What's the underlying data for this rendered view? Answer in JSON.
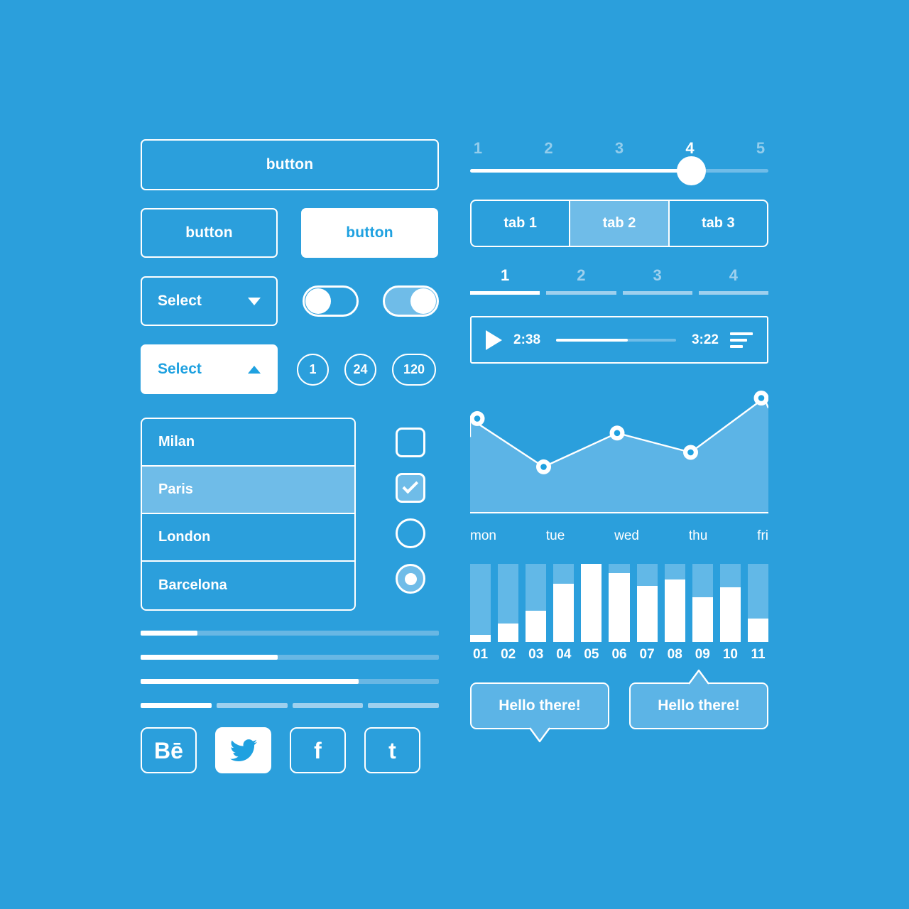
{
  "theme": {
    "background": "#2b9fdc",
    "accent_light": "#6fbce8",
    "white": "#ffffff",
    "text_on_white": "#1fa1e0",
    "muted": "#9ed0ee"
  },
  "buttons": {
    "wide_label": "button",
    "outline_label": "button",
    "solid_label": "button"
  },
  "selects": {
    "outline": {
      "label": "Select",
      "caret": "chevron-down-icon"
    },
    "white": {
      "label": "Select",
      "caret": "chevron-up-icon"
    }
  },
  "toggles": [
    {
      "name": "toggle-off",
      "state": "off"
    },
    {
      "name": "toggle-on",
      "state": "on"
    }
  ],
  "badges": [
    "1",
    "24",
    "120"
  ],
  "city_list": [
    {
      "label": "Milan",
      "selected": false
    },
    {
      "label": "Paris",
      "selected": true
    },
    {
      "label": "London",
      "selected": false
    },
    {
      "label": "Barcelona",
      "selected": false
    }
  ],
  "choices": [
    {
      "type": "checkbox",
      "checked": false
    },
    {
      "type": "checkbox",
      "checked": true
    },
    {
      "type": "radio",
      "checked": false
    },
    {
      "type": "radio",
      "checked": true
    }
  ],
  "progress": {
    "bars": [
      19,
      46,
      73
    ],
    "segmented": {
      "segments": 4,
      "filled": 1
    }
  },
  "socials": [
    {
      "name": "behance-icon",
      "glyph": "Bē",
      "filled": false
    },
    {
      "name": "twitter-icon",
      "glyph": "",
      "filled": true
    },
    {
      "name": "facebook-icon",
      "glyph": "f",
      "filled": false
    },
    {
      "name": "tumblr-icon",
      "glyph": "t",
      "filled": false
    }
  ],
  "slider": {
    "labels": [
      "1",
      "2",
      "3",
      "4",
      "5"
    ],
    "value": 4,
    "min": 1,
    "max": 5,
    "fill_percent": 74
  },
  "tabs": {
    "items": [
      {
        "label": "tab 1",
        "active": false
      },
      {
        "label": "tab 2",
        "active": true
      },
      {
        "label": "tab 3",
        "active": false
      }
    ]
  },
  "pagination": {
    "items": [
      {
        "label": "1",
        "active": true
      },
      {
        "label": "2",
        "active": false
      },
      {
        "label": "3",
        "active": false
      },
      {
        "label": "4",
        "active": false
      }
    ]
  },
  "player": {
    "play_icon": "play-icon",
    "elapsed": "2:38",
    "duration": "3:22",
    "progress_percent": 60,
    "playlist_icon": "playlist-icon"
  },
  "chart_data": [
    {
      "type": "area",
      "title": "",
      "categories": [
        "mon",
        "tue",
        "wed",
        "thu",
        "fri"
      ],
      "values": [
        78,
        38,
        66,
        50,
        95
      ],
      "ylim": [
        0,
        100
      ],
      "xlabel": "",
      "ylabel": "",
      "grid": false,
      "legend": "none",
      "marker": "circle",
      "line_color": "#ffffff",
      "fill_color": "#5cb4e6",
      "marker_fill": "#1fa1e0"
    },
    {
      "type": "bar",
      "title": "",
      "categories": [
        "01",
        "02",
        "03",
        "04",
        "05",
        "06",
        "07",
        "08",
        "09",
        "10",
        "11"
      ],
      "values": [
        9,
        24,
        40,
        75,
        100,
        88,
        72,
        80,
        57,
        70,
        30
      ],
      "ylim": [
        0,
        100
      ],
      "xlabel": "",
      "ylabel": "",
      "grid": false,
      "legend": "none",
      "bar_color": "#ffffff",
      "track_color": "#62b8e7"
    }
  ],
  "tooltips": [
    {
      "text": "Hello there!",
      "tail": "down"
    },
    {
      "text": "Hello there!",
      "tail": "up"
    }
  ]
}
